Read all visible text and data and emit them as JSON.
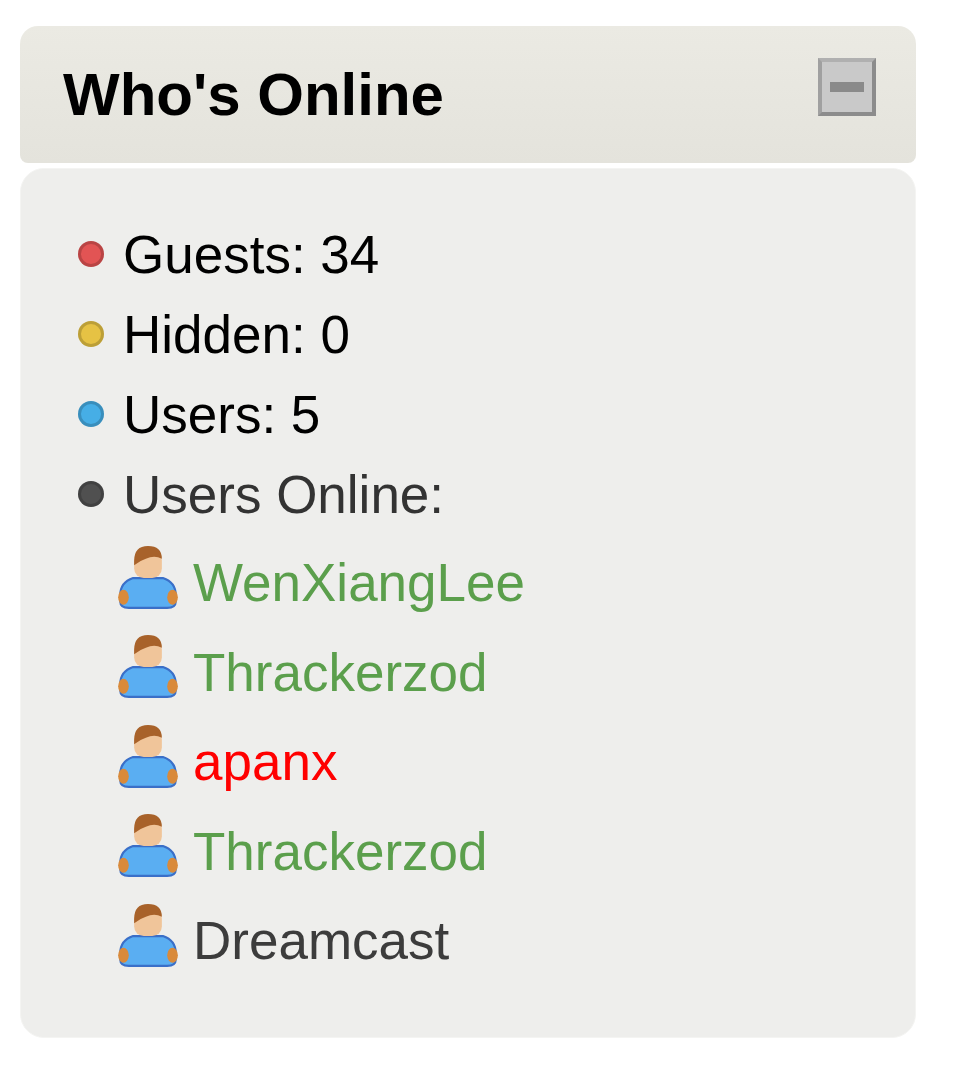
{
  "panel": {
    "title": "Who's Online",
    "expanded": true
  },
  "stats": [
    {
      "label": "Guests: 34",
      "color": "#e25454"
    },
    {
      "label": "Hidden: 0",
      "color": "#e6c244"
    },
    {
      "label": "Users: 5",
      "color": "#46aee6"
    }
  ],
  "users_online": {
    "label": "Users Online:",
    "color": "#505050",
    "users": [
      {
        "name": "WenXiangLee",
        "color": "#5b9f4c"
      },
      {
        "name": "Thrackerzod",
        "color": "#5b9f4c"
      },
      {
        "name": "apanx",
        "color": "#ff0000"
      },
      {
        "name": "Thrackerzod",
        "color": "#5b9f4c"
      },
      {
        "name": "Dreamcast",
        "color": "#3c3c3c"
      }
    ]
  }
}
